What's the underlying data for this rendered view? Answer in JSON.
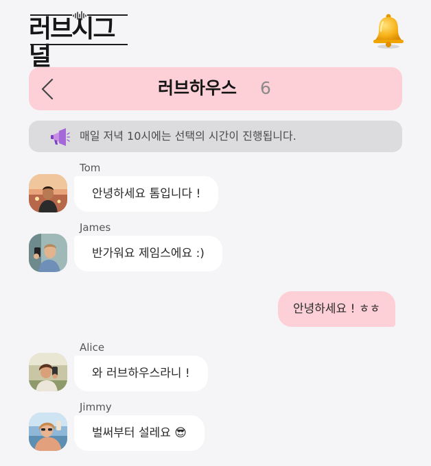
{
  "app": {
    "logo_text": "러브시그널"
  },
  "header": {
    "room_name": "러브하우스",
    "member_count": "6"
  },
  "notice": {
    "text": "매일 저녁 10시에는 선택의 시간이 진행됩니다."
  },
  "messages": [
    {
      "sender": "Tom",
      "text": "안녕하세요 톰입니다 !"
    },
    {
      "sender": "James",
      "text": "반가워요 제임스에요 :)"
    },
    {
      "sender": "",
      "text": "안녕하세요 ! ㅎㅎ"
    },
    {
      "sender": "Alice",
      "text": "와 러브하우스라니 !"
    },
    {
      "sender": "Jimmy",
      "text": "벌써부터 설레요 😎"
    }
  ],
  "colors": {
    "accent_pink": "#fcd0d6",
    "notice_gray": "#dcdcdf",
    "background": "#f5f5f7"
  }
}
